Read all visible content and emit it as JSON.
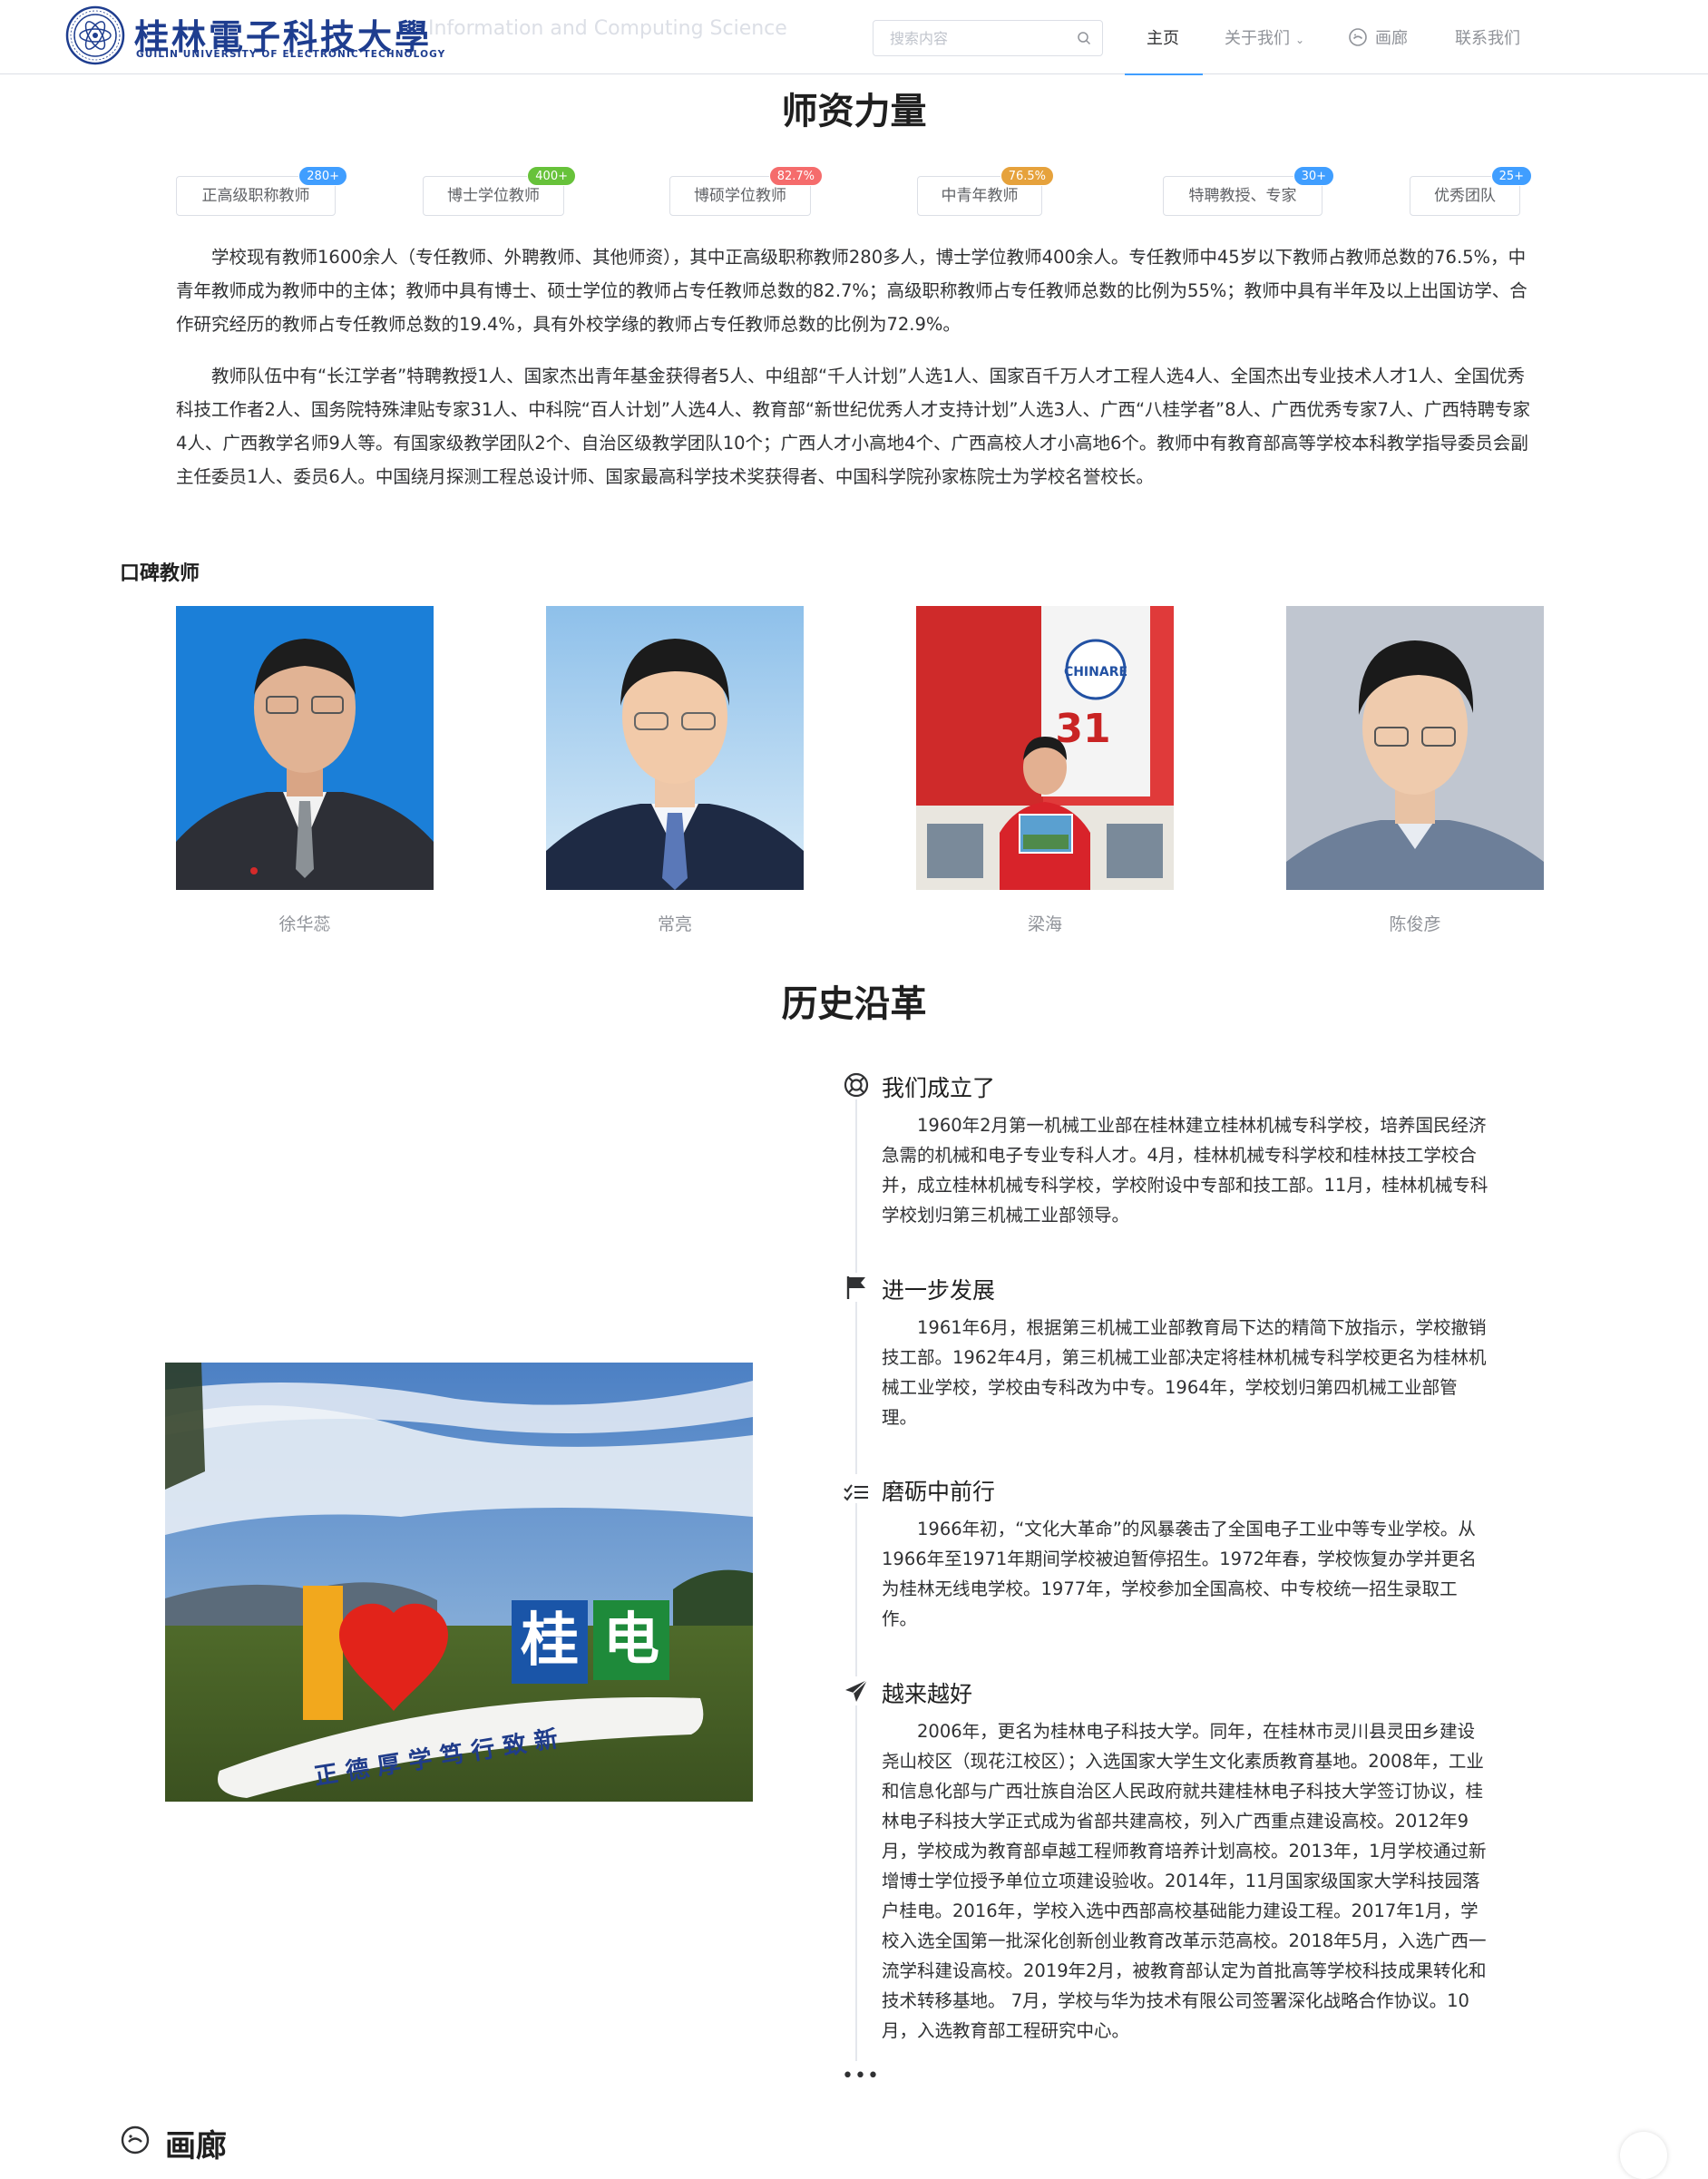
{
  "header": {
    "logo_cn": "桂林電子科技大學",
    "logo_en": "GUILIN UNIVERSITY OF ELECTRONIC TECHNOLOGY",
    "subtitle": "Information and Computing Science",
    "search_placeholder": "搜索内容",
    "nav": {
      "home": "主页",
      "about": "关于我们",
      "gallery": "画廊",
      "contact": "联系我们"
    },
    "accent_color": "#409eff",
    "brand_color": "#1e3d8f"
  },
  "faculty": {
    "title": "师资力量",
    "stats": [
      {
        "label": "正高级职称教师",
        "badge": "280+",
        "badge_color": "#409eff"
      },
      {
        "label": "博士学位教师",
        "badge": "400+",
        "badge_color": "#67c23a"
      },
      {
        "label": "博硕学位教师",
        "badge": "82.7%",
        "badge_color": "#f56c6c"
      },
      {
        "label": "中青年教师",
        "badge": "76.5%",
        "badge_color": "#e6a23c"
      },
      {
        "label": "特聘教授、专家",
        "badge": "30+",
        "badge_color": "#409eff"
      },
      {
        "label": "优秀团队",
        "badge": "25+",
        "badge_color": "#409eff"
      }
    ],
    "paragraph1": "学校现有教师1600余人（专任教师、外聘教师、其他师资），其中正高级职称教师280多人，博士学位教师400余人。专任教师中45岁以下教师占教师总数的76.5%，中青年教师成为教师中的主体；教师中具有博士、硕士学位的教师占专任教师总数的82.7%；高级职称教师占专任教师总数的比例为55%；教师中具有半年及以上出国访学、合作研究经历的教师占专任教师总数的19.4%，具有外校学缘的教师占专任教师总数的比例为72.9%。",
    "paragraph2": "教师队伍中有“长江学者”特聘教授1人、国家杰出青年基金获得者5人、中组部“千人计划”人选1人、国家百千万人才工程人选4人、全国杰出专业技术人才1人、全国优秀科技工作者2人、国务院特殊津贴专家31人、中科院“百人计划”人选4人、教育部“新世纪优秀人才支持计划”人选3人、广西“八桂学者”8人、广西优秀专家7人、广西特聘专家4人、广西教学名师9人等。有国家级教学团队2个、自治区级教学团队10个；广西人才小高地4个、广西高校人才小高地6个。教师中有教育部高等学校本科教学指导委员会副主任委员1人、委员6人。中国绕月探测工程总设计师、国家最高科学技术奖获得者、中国科学院孙家栋院士为学校名誉校长。"
  },
  "teachers": {
    "title": "口碑教师",
    "items": [
      {
        "name": "徐华蕊"
      },
      {
        "name": "常亮"
      },
      {
        "name": "梁海"
      },
      {
        "name": "陈俊彦"
      }
    ]
  },
  "history": {
    "title": "历史沿革",
    "items": [
      {
        "title": "我们成立了",
        "icon": "lifebuoy-icon",
        "text": "1960年2月第一机械工业部在桂林建立桂林机械专科学校，培养国民经济急需的机械和电子专业专科人才。4月，桂林机械专科学校和桂林技工学校合并，成立桂林机械专科学校，学校附设中专部和技工部。11月，桂林机械专科学校划归第三机械工业部领导。"
      },
      {
        "title": "进一步发展",
        "icon": "flag-icon",
        "text": "1961年6月，根据第三机械工业部教育局下达的精简下放指示，学校撤销技工部。1962年4月，第三机械工业部决定将桂林机械专科学校更名为桂林机械工业学校，学校由专科改为中专。1964年，学校划归第四机械工业部管理。"
      },
      {
        "title": "磨砺中前行",
        "icon": "checklist-icon",
        "text": "1966年初，“文化大革命”的风暴袭击了全国电子工业中等专业学校。从1966年至1971年期间学校被迫暂停招生。1972年春，学校恢复办学并更名为桂林无线电学校。1977年，学校参加全国高校、中专校统一招生录取工作。"
      },
      {
        "title": "越来越好",
        "icon": "paper-plane-icon",
        "text": "2006年，更名为桂林电子科技大学。同年，在桂林市灵川县灵田乡建设尧山校区（现花江校区）；入选国家大学生文化素质教育基地。2008年，工业和信息化部与广西壮族自治区人民政府就共建桂林电子科技大学签订协议，桂林电子科技大学正式成为省部共建高校，列入广西重点建设高校。2012年9月，学校成为教育部卓越工程师教育培养计划高校。2013年，1月学校通过新增博士学位授予单位立项建设验收。2014年，11月国家级国家大学科技园落户桂电。2016年，学校入选中西部高校基础能力建设工程。2017年1月，学校入选全国第一批深化创新创业教育改革示范高校。2018年5月，入选广西一流学科建设高校。2019年2月，被教育部认定为首批高等学校科技成果转化和技术转移基地。 7月，学校与华为技术有限公司签署深化战略合作协议。10月，入选教育部工程研究中心。"
      }
    ],
    "more": "•••"
  },
  "sign": {
    "letter": "I",
    "chars": "桂电",
    "base_text": "正 德 厚 学 笃 行 致 新"
  },
  "gallery": {
    "title": "画廊"
  }
}
